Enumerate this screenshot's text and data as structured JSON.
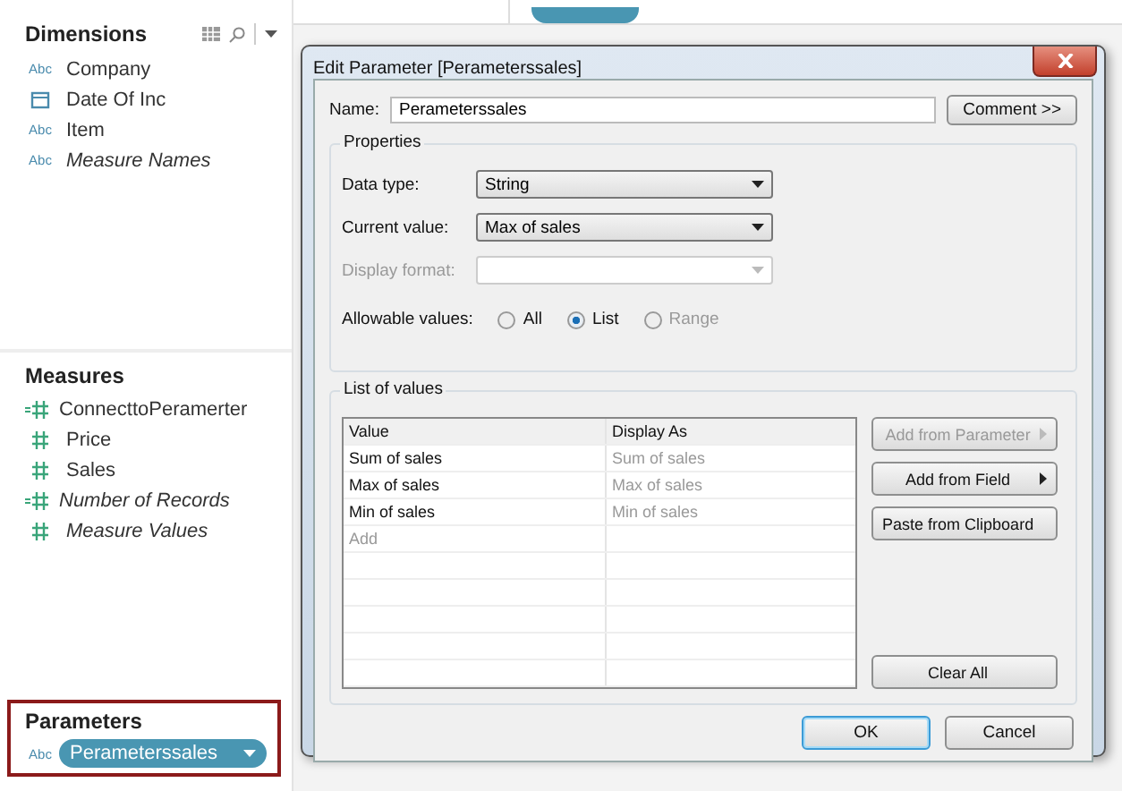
{
  "sidebar": {
    "dimensions": {
      "title": "Dimensions",
      "items": [
        {
          "name": "Company",
          "kind": "string",
          "badge": "Abc",
          "italic": false
        },
        {
          "name": "Date Of Inc",
          "kind": "date",
          "italic": false
        },
        {
          "name": "Item",
          "kind": "string",
          "badge": "Abc",
          "italic": false
        },
        {
          "name": "Measure Names",
          "kind": "string",
          "badge": "Abc",
          "italic": true
        }
      ]
    },
    "measures": {
      "title": "Measures",
      "items": [
        {
          "name": "ConnecttoPeramerter",
          "kind": "calculated",
          "italic": false
        },
        {
          "name": "Price",
          "kind": "number",
          "italic": false
        },
        {
          "name": "Sales",
          "kind": "number",
          "italic": false
        },
        {
          "name": "Number of Records",
          "kind": "calculated",
          "italic": true
        },
        {
          "name": "Measure Values",
          "kind": "number",
          "italic": true
        }
      ]
    },
    "parameters": {
      "title": "Parameters",
      "items": [
        {
          "name": "Perameterssales",
          "kind": "string",
          "badge": "Abc",
          "selected": true
        }
      ]
    }
  },
  "dialog": {
    "title": "Edit Parameter [Perameterssales]",
    "name_label": "Name:",
    "name_value": "Perameterssales",
    "comment_button": "Comment >>",
    "properties": {
      "title": "Properties",
      "fields": [
        {
          "label": "Data type:",
          "value": "String",
          "disabled": false
        },
        {
          "label": "Current value:",
          "value": "Max of sales",
          "disabled": false
        },
        {
          "label": "Display format:",
          "disabled": true
        }
      ],
      "allowable_label": "Allowable values:",
      "options": [
        {
          "label": "All",
          "selected": false,
          "disabled": false
        },
        {
          "label": "List",
          "selected": true,
          "disabled": false
        },
        {
          "label": "Range",
          "selected": false,
          "disabled": true
        }
      ]
    },
    "list": {
      "title": "List of values",
      "columns": [
        "Value",
        "Display As"
      ],
      "rows": [
        {
          "value": "Sum of sales",
          "display": "Sum of sales"
        },
        {
          "value": "Max of sales",
          "display": "Max of sales"
        },
        {
          "value": "Min of sales",
          "display": "Min of sales"
        }
      ],
      "add_placeholder": "Add",
      "buttons": [
        {
          "label": "Add from Parameter",
          "disabled": true,
          "submenu": true
        },
        {
          "label": "Add from Field",
          "disabled": false,
          "submenu": true
        },
        {
          "label": "Paste from Clipboard",
          "disabled": false,
          "submenu": false
        }
      ],
      "clear_button": "Clear All"
    },
    "footer": [
      {
        "label": "OK",
        "default": true
      },
      {
        "label": "Cancel",
        "default": false
      }
    ]
  }
}
